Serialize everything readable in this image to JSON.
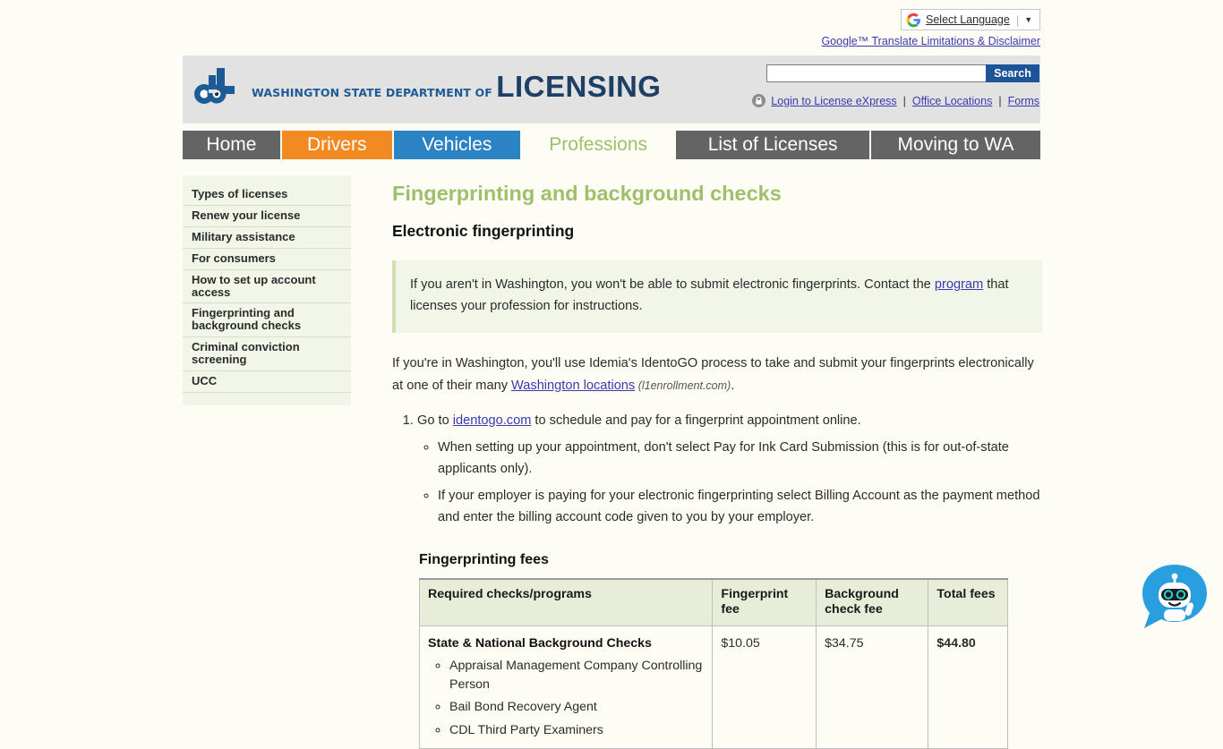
{
  "translate_bar": {
    "widget_label": "Select Language",
    "caret": "▼",
    "disclaimer_link": "Google™ Translate Limitations & Disclaimer"
  },
  "header": {
    "logo_line1": "WASHINGTON STATE DEPARTMENT OF",
    "logo_line2": "LICENSING",
    "logo_monogram": "dol",
    "search": {
      "value": "",
      "placeholder": "",
      "button_label": "Search"
    },
    "utility_links": [
      {
        "label": "Login to License eXpress",
        "icon": "lock-icon"
      },
      {
        "label": "Office Locations"
      },
      {
        "label": "Forms"
      }
    ],
    "separator": "|"
  },
  "nav": {
    "tabs": [
      {
        "label": "Home",
        "key": "home",
        "active": false
      },
      {
        "label": "Drivers",
        "key": "drivers",
        "active": false
      },
      {
        "label": "Vehicles",
        "key": "vehicles",
        "active": false
      },
      {
        "label": "Professions",
        "key": "professions",
        "active": true
      },
      {
        "label": "List of Licenses",
        "key": "list-of-licenses",
        "active": false
      },
      {
        "label": "Moving to WA",
        "key": "moving-to-wa",
        "active": false
      }
    ]
  },
  "sidebar": {
    "items": [
      {
        "label": "Types of licenses"
      },
      {
        "label": "Renew your license"
      },
      {
        "label": "Military assistance"
      },
      {
        "label": "For consumers"
      },
      {
        "label": "How to set up account access"
      },
      {
        "label": "Fingerprinting and background checks"
      },
      {
        "label": "Criminal conviction screening"
      },
      {
        "label": "UCC"
      }
    ]
  },
  "main": {
    "page_title": "Fingerprinting and background checks",
    "section_title": "Electronic fingerprinting",
    "callout": {
      "text_before_link": "If you aren't in Washington, you won't be able to submit electronic fingerprints. Contact the ",
      "link": "program",
      "text_after_link": " that licenses your profession for instructions."
    },
    "intro": {
      "text_before_link": "If you're in Washington, you'll use Idemia's IdentoGO process to take and submit your fingerprints electronically at one of their many ",
      "link": "Washington locations",
      "citation": " (l1enrollment.com)",
      "text_after": "."
    },
    "steps": [
      {
        "text_before_link": "Go to ",
        "link": "identogo.com",
        "text_after_link": " to schedule and pay for a fingerprint appointment online.",
        "substeps": [
          "When setting up your appointment, don't select Pay for Ink Card Submission (this is for out-of-state applicants only).",
          "If your employer is paying for your electronic fingerprinting select Billing Account as the payment method and enter the billing account code given to you by your employer."
        ]
      }
    ],
    "fees_table": {
      "title": "Fingerprinting fees",
      "columns": [
        "Required checks/programs",
        "Fingerprint fee",
        "Background check fee",
        "Total fees"
      ],
      "rows": [
        {
          "program_title": "State & National Background Checks",
          "programs": [
            "Appraisal Management Company Controlling Person",
            "Bail Bond Recovery Agent",
            "CDL Third Party Examiners"
          ],
          "fingerprint_fee": "$10.05",
          "background_check_fee": "$34.75",
          "total_fees": "$44.80"
        }
      ]
    }
  },
  "chatbot": {
    "name": "chat-assistant-icon"
  },
  "colors": {
    "page_background": "#fdfdf6",
    "header_band": "#e2e2e2",
    "nav_gray": "#646464",
    "nav_orange": "#f18b21",
    "nav_blue": "#2b83c3",
    "accent_green": "#9fc06a",
    "panel_green": "#f2f6e9",
    "table_header_green": "#e7edd9",
    "link_blue": "#3a3ab0",
    "search_button_blue": "#1c5499",
    "logo_blue": "#1d5b96",
    "chatbot_blue": "#2a9fe0"
  }
}
